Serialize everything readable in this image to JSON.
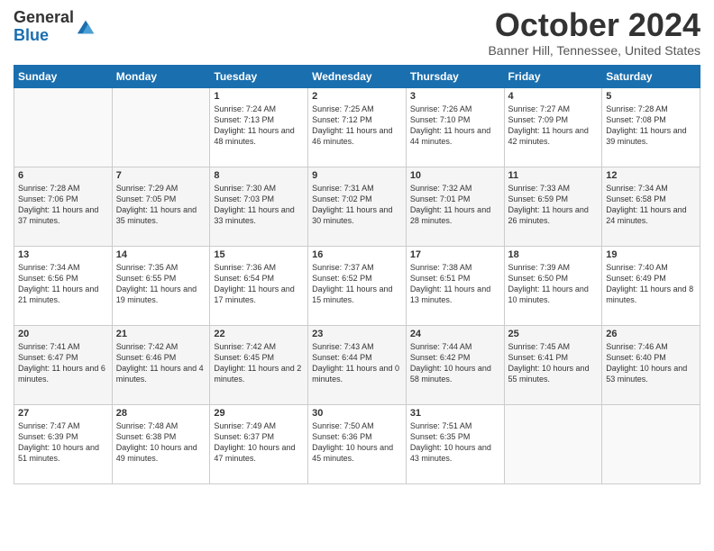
{
  "logo": {
    "general": "General",
    "blue": "Blue"
  },
  "title": "October 2024",
  "location": "Banner Hill, Tennessee, United States",
  "days": [
    "Sunday",
    "Monday",
    "Tuesday",
    "Wednesday",
    "Thursday",
    "Friday",
    "Saturday"
  ],
  "weeks": [
    [
      {
        "num": "",
        "info": ""
      },
      {
        "num": "",
        "info": ""
      },
      {
        "num": "1",
        "info": "Sunrise: 7:24 AM\nSunset: 7:13 PM\nDaylight: 11 hours and 48 minutes."
      },
      {
        "num": "2",
        "info": "Sunrise: 7:25 AM\nSunset: 7:12 PM\nDaylight: 11 hours and 46 minutes."
      },
      {
        "num": "3",
        "info": "Sunrise: 7:26 AM\nSunset: 7:10 PM\nDaylight: 11 hours and 44 minutes."
      },
      {
        "num": "4",
        "info": "Sunrise: 7:27 AM\nSunset: 7:09 PM\nDaylight: 11 hours and 42 minutes."
      },
      {
        "num": "5",
        "info": "Sunrise: 7:28 AM\nSunset: 7:08 PM\nDaylight: 11 hours and 39 minutes."
      }
    ],
    [
      {
        "num": "6",
        "info": "Sunrise: 7:28 AM\nSunset: 7:06 PM\nDaylight: 11 hours and 37 minutes."
      },
      {
        "num": "7",
        "info": "Sunrise: 7:29 AM\nSunset: 7:05 PM\nDaylight: 11 hours and 35 minutes."
      },
      {
        "num": "8",
        "info": "Sunrise: 7:30 AM\nSunset: 7:03 PM\nDaylight: 11 hours and 33 minutes."
      },
      {
        "num": "9",
        "info": "Sunrise: 7:31 AM\nSunset: 7:02 PM\nDaylight: 11 hours and 30 minutes."
      },
      {
        "num": "10",
        "info": "Sunrise: 7:32 AM\nSunset: 7:01 PM\nDaylight: 11 hours and 28 minutes."
      },
      {
        "num": "11",
        "info": "Sunrise: 7:33 AM\nSunset: 6:59 PM\nDaylight: 11 hours and 26 minutes."
      },
      {
        "num": "12",
        "info": "Sunrise: 7:34 AM\nSunset: 6:58 PM\nDaylight: 11 hours and 24 minutes."
      }
    ],
    [
      {
        "num": "13",
        "info": "Sunrise: 7:34 AM\nSunset: 6:56 PM\nDaylight: 11 hours and 21 minutes."
      },
      {
        "num": "14",
        "info": "Sunrise: 7:35 AM\nSunset: 6:55 PM\nDaylight: 11 hours and 19 minutes."
      },
      {
        "num": "15",
        "info": "Sunrise: 7:36 AM\nSunset: 6:54 PM\nDaylight: 11 hours and 17 minutes."
      },
      {
        "num": "16",
        "info": "Sunrise: 7:37 AM\nSunset: 6:52 PM\nDaylight: 11 hours and 15 minutes."
      },
      {
        "num": "17",
        "info": "Sunrise: 7:38 AM\nSunset: 6:51 PM\nDaylight: 11 hours and 13 minutes."
      },
      {
        "num": "18",
        "info": "Sunrise: 7:39 AM\nSunset: 6:50 PM\nDaylight: 11 hours and 10 minutes."
      },
      {
        "num": "19",
        "info": "Sunrise: 7:40 AM\nSunset: 6:49 PM\nDaylight: 11 hours and 8 minutes."
      }
    ],
    [
      {
        "num": "20",
        "info": "Sunrise: 7:41 AM\nSunset: 6:47 PM\nDaylight: 11 hours and 6 minutes."
      },
      {
        "num": "21",
        "info": "Sunrise: 7:42 AM\nSunset: 6:46 PM\nDaylight: 11 hours and 4 minutes."
      },
      {
        "num": "22",
        "info": "Sunrise: 7:42 AM\nSunset: 6:45 PM\nDaylight: 11 hours and 2 minutes."
      },
      {
        "num": "23",
        "info": "Sunrise: 7:43 AM\nSunset: 6:44 PM\nDaylight: 11 hours and 0 minutes."
      },
      {
        "num": "24",
        "info": "Sunrise: 7:44 AM\nSunset: 6:42 PM\nDaylight: 10 hours and 58 minutes."
      },
      {
        "num": "25",
        "info": "Sunrise: 7:45 AM\nSunset: 6:41 PM\nDaylight: 10 hours and 55 minutes."
      },
      {
        "num": "26",
        "info": "Sunrise: 7:46 AM\nSunset: 6:40 PM\nDaylight: 10 hours and 53 minutes."
      }
    ],
    [
      {
        "num": "27",
        "info": "Sunrise: 7:47 AM\nSunset: 6:39 PM\nDaylight: 10 hours and 51 minutes."
      },
      {
        "num": "28",
        "info": "Sunrise: 7:48 AM\nSunset: 6:38 PM\nDaylight: 10 hours and 49 minutes."
      },
      {
        "num": "29",
        "info": "Sunrise: 7:49 AM\nSunset: 6:37 PM\nDaylight: 10 hours and 47 minutes."
      },
      {
        "num": "30",
        "info": "Sunrise: 7:50 AM\nSunset: 6:36 PM\nDaylight: 10 hours and 45 minutes."
      },
      {
        "num": "31",
        "info": "Sunrise: 7:51 AM\nSunset: 6:35 PM\nDaylight: 10 hours and 43 minutes."
      },
      {
        "num": "",
        "info": ""
      },
      {
        "num": "",
        "info": ""
      }
    ]
  ]
}
